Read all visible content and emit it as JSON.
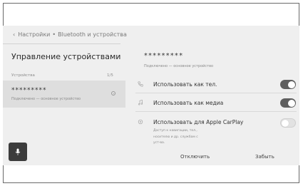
{
  "breadcrumb": {
    "back_icon": "chevron-left-icon",
    "item1": "Настройки",
    "separator": "•",
    "item2": "Bluetooth и устройства"
  },
  "left_panel": {
    "title": "Управление устройствами",
    "section_label": "Устройства",
    "section_count": "1/5",
    "device": {
      "name": "*********",
      "subtitle": "Подключено — основное устройство"
    },
    "mic_icon": "microphone-icon"
  },
  "right_panel": {
    "device_name": "*********",
    "device_subtitle": "Подключено — основное устройство",
    "options": [
      {
        "icon": "phone-icon",
        "label": "Использовать как тел.",
        "enabled": true
      },
      {
        "icon": "music-note-icon",
        "label": "Использовать как медиа",
        "enabled": true
      },
      {
        "icon": "carplay-icon",
        "label": "Использовать для Apple CarPlay",
        "enabled": false,
        "description": "Доступ к навигации, тел., носителю и др. службам с уст-ва."
      }
    ],
    "disconnect_label": "Отключить",
    "forget_label": "Забыть"
  },
  "colors": {
    "background": "#efefef",
    "selected_row": "#dedede",
    "toggle_on": "#5e5e5e",
    "toggle_off": "#e2e2e2",
    "mic_button": "#3c3c3c"
  }
}
